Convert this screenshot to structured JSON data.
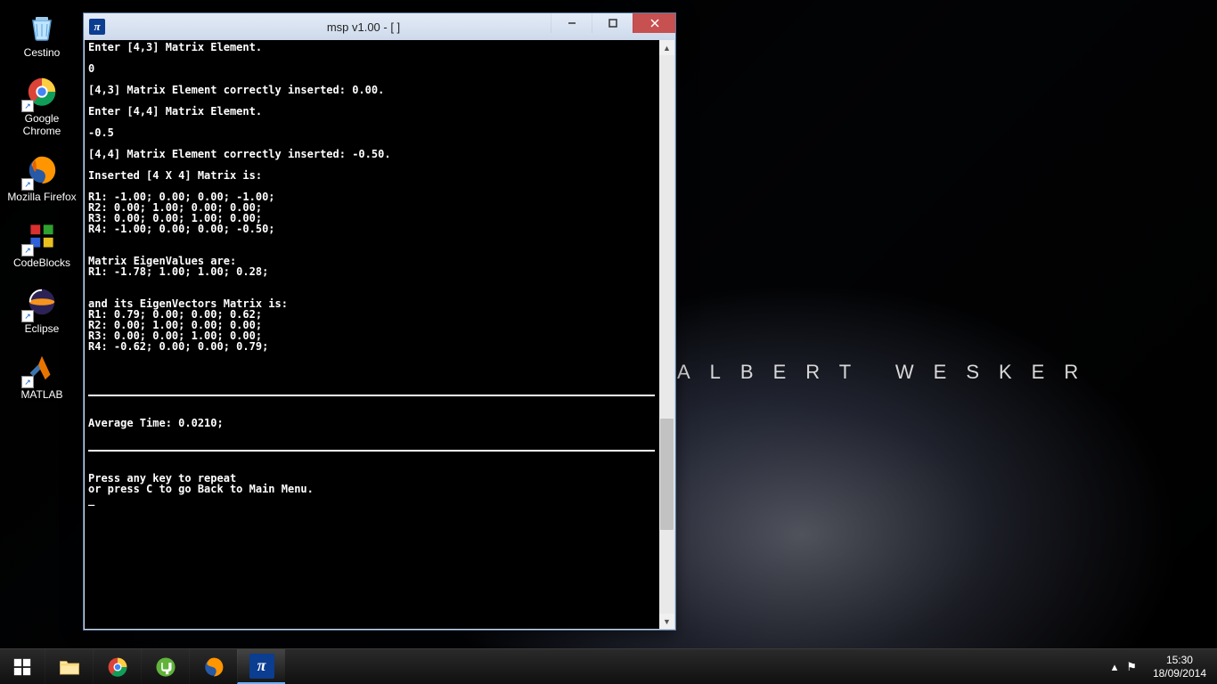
{
  "wallpaper": {
    "text": "ALBERT WESKER"
  },
  "desktop": {
    "items": [
      {
        "label": "Cestino"
      },
      {
        "label": "Google Chrome"
      },
      {
        "label": "Mozilla Firefox"
      },
      {
        "label": "CodeBlocks"
      },
      {
        "label": "Eclipse"
      },
      {
        "label": "MATLAB"
      }
    ]
  },
  "window": {
    "title": "msp v1.00 - [  ]",
    "icon_glyph": "π"
  },
  "console": {
    "lines": [
      "Enter [4,3] Matrix Element.",
      "",
      "0",
      "",
      "[4,3] Matrix Element correctly inserted: 0.00.",
      "",
      "Enter [4,4] Matrix Element.",
      "",
      "-0.5",
      "",
      "[4,4] Matrix Element correctly inserted: -0.50.",
      "",
      "Inserted [4 X 4] Matrix is:",
      "",
      "R1: -1.00; 0.00; 0.00; -1.00;",
      "R2: 0.00; 1.00; 0.00; 0.00;",
      "R3: 0.00; 0.00; 1.00; 0.00;",
      "R4: -1.00; 0.00; 0.00; -0.50;",
      "",
      "",
      "Matrix EigenValues are:",
      "R1: -1.78; 1.00; 1.00; 0.28;",
      "",
      "",
      "and its EigenVectors Matrix is:",
      "R1: 0.79; 0.00; 0.00; 0.62;",
      "R2: 0.00; 1.00; 0.00; 0.00;",
      "R3: 0.00; 0.00; 1.00; 0.00;",
      "R4: -0.62; 0.00; 0.00; 0.79;"
    ],
    "avg_time_line": "Average Time: 0.0210;",
    "footer1": "Press any key to repeat",
    "footer2": "or press C to go Back to Main Menu.",
    "cursor": "_"
  },
  "taskbar": {
    "clock_time": "15:30",
    "clock_date": "18/09/2014"
  }
}
